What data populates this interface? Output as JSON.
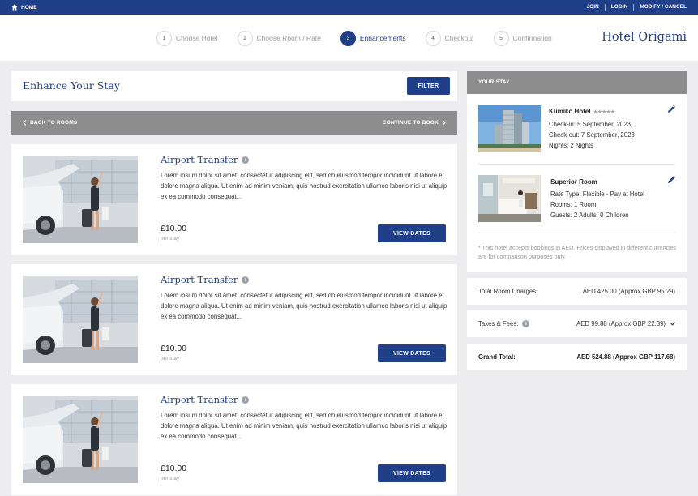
{
  "topbar": {
    "home_label": "HOME",
    "links": [
      "JOIN",
      "LOGIN",
      "MODIFY / CANCEL"
    ]
  },
  "header": {
    "brand": "Hotel Origami",
    "steps": [
      {
        "num": "1",
        "label": "Choose Hotel",
        "active": false
      },
      {
        "num": "2",
        "label": "Choose Room / Rate",
        "active": false
      },
      {
        "num": "3",
        "label": "Enhancements",
        "active": true
      },
      {
        "num": "4",
        "label": "Checkout",
        "active": false
      },
      {
        "num": "5",
        "label": "Confirmation",
        "active": false
      }
    ]
  },
  "main": {
    "title": "Enhance Your Stay",
    "filter_label": "FILTER",
    "back_label": "BACK TO ROOMS",
    "continue_label": "CONTINUE TO BOOK",
    "enhancements": [
      {
        "title": "Airport Transfer",
        "description": "Lorem ipsum dolor sit amet, consectetur adipiscing elit, sed do eiusmod tempor incididunt ut labore et dolore magna aliqua. Ut enim ad minim veniam, quis nostrud exercitation ullamco laboris nisi ut aliquip ex ea commodo consequat...",
        "price": "£10.00",
        "per": "per stay",
        "button": "VIEW DATES"
      },
      {
        "title": "Airport Transfer",
        "description": "Lorem ipsum dolor sit amet, consectetur adipiscing elit, sed do eiusmod tempor incididunt ut labore et dolore magna aliqua. Ut enim ad minim veniam, quis nostrud exercitation ullamco laboris nisi ut aliquip ex ea commodo consequat...",
        "price": "£10.00",
        "per": "per stay",
        "button": "VIEW DATES"
      },
      {
        "title": "Airport Transfer",
        "description": "Lorem ipsum dolor sit amet, consectetur adipiscing elit, sed do eiusmod tempor incididunt ut labore et dolore magna aliqua. Ut enim ad minim veniam, quis nostrud exercitation ullamco laboris nisi ut aliquip ex ea commodo consequat...",
        "price": "£10.00",
        "per": "per stay",
        "button": "VIEW DATES"
      }
    ]
  },
  "stay": {
    "heading": "YOUR STAY",
    "hotel_name": "Kumiko Hotel",
    "rating": "★★★★★",
    "check_in": "Check-in: 5 September, 2023",
    "check_out": "Check-out: 7 September, 2023",
    "nights": "Nights: 2 Nights",
    "room_name": "Superior Room",
    "rate_type": "Rate Type: Flexible - Pay at Hotel",
    "rooms": "Rooms: 1 Room",
    "guests": "Guests: 2 Adults, 0 Children",
    "note": "* This hotel accepts bookings in AED. Prices displayed in different currencies are for comparison purposes only."
  },
  "summary": {
    "room_charges_label": "Total Room Charges:",
    "room_charges_value": "AED 425.00 (Approx GBP 95.29)",
    "taxes_label": "Taxes & Fees:",
    "taxes_value": "AED 99.88 (Approx GBP 22.39)",
    "total_label": "Grand Total:",
    "total_value": "AED 524.88 (Approx GBP 117.68)"
  },
  "colors": {
    "brand_blue": "#1f3f88",
    "grey_bar": "#8d8d8d",
    "page_bg": "#ededf0"
  },
  "icons": [
    "home-icon",
    "chevron-left-icon",
    "chevron-right-icon",
    "info-icon",
    "star-icon",
    "pencil-icon",
    "chevron-down-icon"
  ]
}
